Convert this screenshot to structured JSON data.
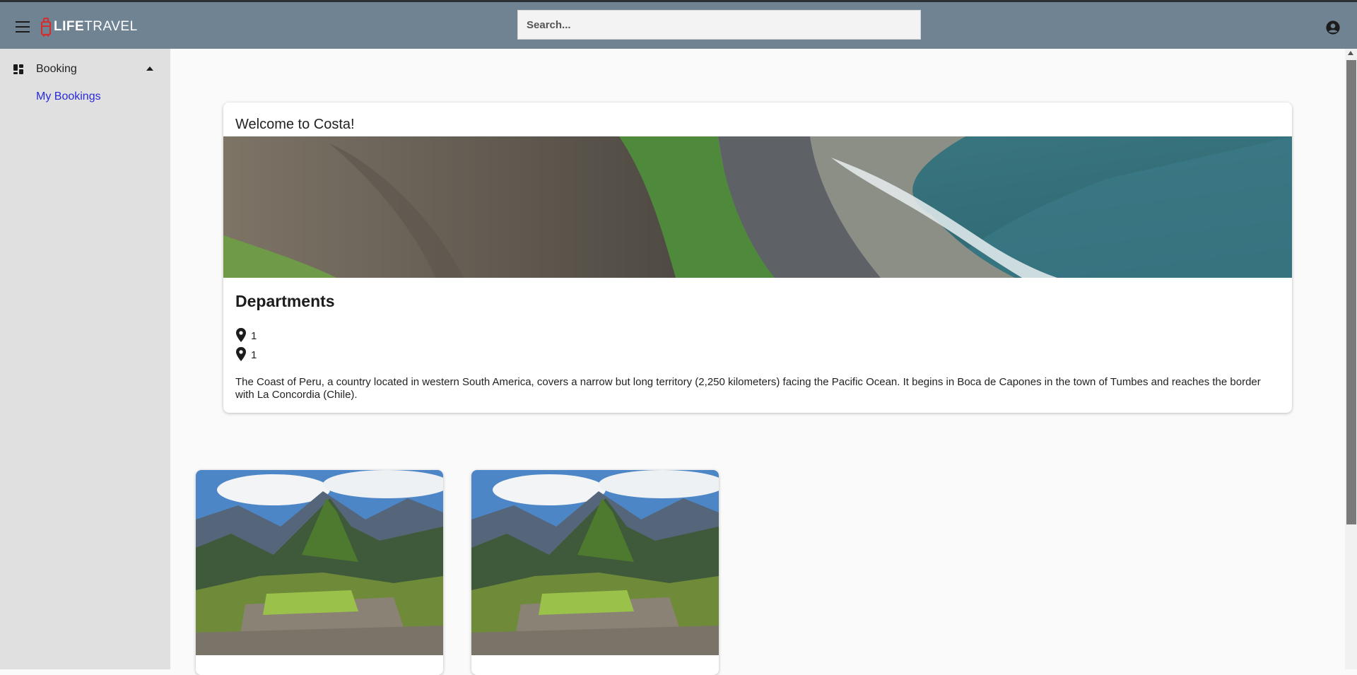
{
  "header": {
    "logo_bold": "LIFE",
    "logo_thin": "TRAVEL",
    "search_placeholder": "Search..."
  },
  "sidebar": {
    "section_label": "Booking",
    "items": [
      {
        "label": "My Bookings"
      }
    ]
  },
  "feature_card": {
    "title": "Welcome to Costa!",
    "heading": "Departments",
    "locations": [
      {
        "value": "1"
      },
      {
        "value": "1"
      }
    ],
    "description": "The Coast of Peru, a country located in western South America, covers a narrow but long territory (2,250 kilometers) facing the Pacific Ocean. It begins in Boca de Capones in the town of Tumbes and reaches the border with La Concordia (Chile)."
  },
  "destination_cards": [
    {
      "image": "machu-picchu-photo"
    },
    {
      "image": "machu-picchu-photo"
    }
  ],
  "colors": {
    "topbar": "#708393",
    "sidebar": "#e0e0e0",
    "link": "#2a2ad8",
    "brand_red": "#d32f2f"
  }
}
